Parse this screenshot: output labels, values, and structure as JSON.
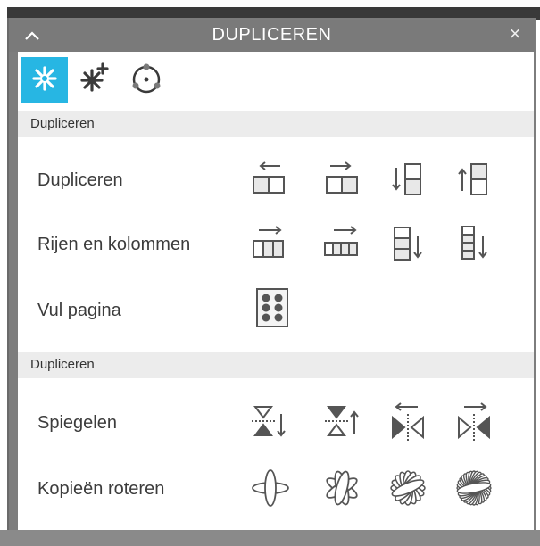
{
  "panel": {
    "title": "DUPLICEREN",
    "close_glyph": "×",
    "collapse_icon": "chevron-up-icon"
  },
  "tool_tabs": [
    {
      "name": "duplicate-tool",
      "icon": "duplicate-burst-icon",
      "active": true
    },
    {
      "name": "duplicate-add-tool",
      "icon": "duplicate-burst-plus-icon",
      "active": false
    },
    {
      "name": "rotate-copies-tool",
      "icon": "rotate-circle-icon",
      "active": false
    }
  ],
  "sections": [
    {
      "header": "Dupliceren",
      "rows": [
        {
          "label": "Dupliceren",
          "icons": [
            "duplicate-left-icon",
            "duplicate-right-icon",
            "duplicate-below-icon",
            "duplicate-above-icon"
          ]
        },
        {
          "label": "Rijen en kolommen",
          "icons": [
            "row-of-three-icon",
            "row-of-four-icon",
            "column-of-three-icon",
            "column-of-four-icon"
          ]
        },
        {
          "label": "Vul pagina",
          "icons": [
            "fill-page-icon"
          ]
        }
      ]
    },
    {
      "header": "Dupliceren",
      "rows": [
        {
          "label": "Spiegelen",
          "icons": [
            "mirror-below-icon",
            "mirror-above-icon",
            "mirror-left-icon",
            "mirror-right-icon"
          ]
        },
        {
          "label": "Kopieën roteren",
          "icons": [
            "rotate-two-copies-icon",
            "rotate-four-copies-icon",
            "rotate-eight-copies-icon",
            "rotate-sixteen-copies-icon"
          ]
        }
      ]
    }
  ],
  "colors": {
    "accent": "#27b6e3",
    "panel_frame": "#7a7a7a",
    "section_header_bg": "#ececec",
    "icon_stroke": "#555555"
  }
}
